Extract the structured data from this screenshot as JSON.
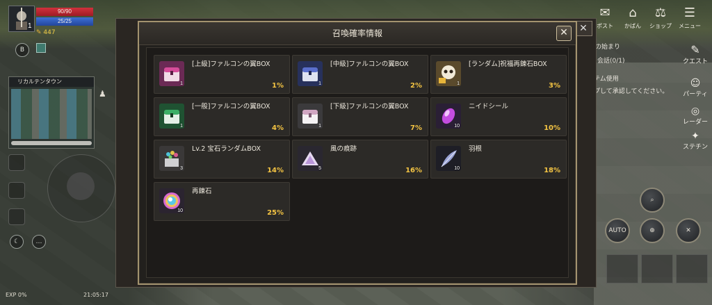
{
  "hud": {
    "level": "1",
    "hp": "90/90",
    "mp": "25/25",
    "gold": "447",
    "b_button": "B",
    "minimap_title": "リカルテンタウン",
    "exp": "EXP 0%",
    "time": "21:05:17"
  },
  "top_right": {
    "post": "ポスト",
    "bag": "かばん",
    "shop": "ショップ",
    "menu": "メニュー"
  },
  "right_side": {
    "quest": "クエスト",
    "party": "パーティ",
    "radar": "レーダー",
    "stagecraft": "ステチン",
    "auto": "AUTO",
    "quest_text_1": "の始まり",
    "quest_text_2": "と会話(0/1)",
    "quest_text_3": "テム使用",
    "quest_text_4": "プして承認してください。"
  },
  "modal": {
    "title": "召喚確率情報",
    "close": "✕"
  },
  "items": [
    {
      "name": "[上級]ファルコンの翼BOX",
      "rate": "1%",
      "qty": "1",
      "icon": "chest-pink-icon"
    },
    {
      "name": "[中級]ファルコンの翼BOX",
      "rate": "2%",
      "qty": "1",
      "icon": "chest-blue-icon"
    },
    {
      "name": "[ランダム]祝福再錬石BOX",
      "rate": "3%",
      "qty": "1",
      "icon": "skull-box-icon"
    },
    {
      "name": "[一般]ファルコンの翼BOX",
      "rate": "4%",
      "qty": "1",
      "icon": "chest-green-icon"
    },
    {
      "name": "[下級]ファルコンの翼BOX",
      "rate": "7%",
      "qty": "1",
      "icon": "chest-white-icon"
    },
    {
      "name": "ニイドシール",
      "rate": "10%",
      "qty": "10",
      "icon": "purple-gem-icon"
    },
    {
      "name": "Lv.2 宝石ランダムBOX",
      "rate": "14%",
      "qty": "3",
      "icon": "jewel-box-icon"
    },
    {
      "name": "風の痕跡",
      "rate": "16%",
      "qty": "5",
      "icon": "wind-trace-icon"
    },
    {
      "name": "羽根",
      "rate": "18%",
      "qty": "10",
      "icon": "feather-icon"
    },
    {
      "name": "再錬石",
      "rate": "25%",
      "qty": "10",
      "icon": "rainbow-stone-icon"
    }
  ]
}
